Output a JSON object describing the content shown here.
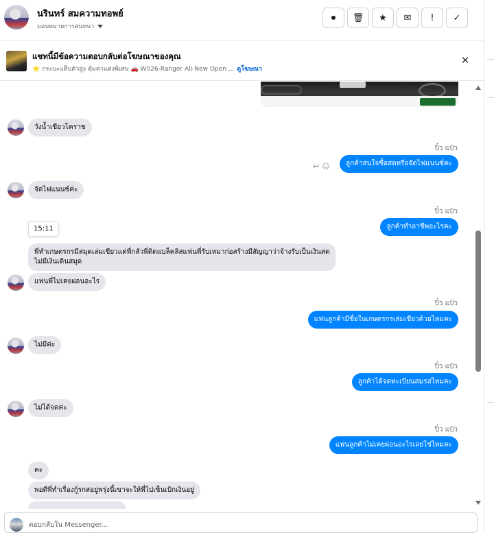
{
  "header": {
    "contact_name": "นรินทร์ สมความทอพย์",
    "assign_label": "มอบหมายการสนทนา",
    "toolbar": [
      {
        "icon": "alert-circle-icon",
        "glyph": "⏺"
      },
      {
        "icon": "trash-icon",
        "glyph": "🗑"
      },
      {
        "icon": "star-icon",
        "glyph": "★"
      },
      {
        "icon": "mail-icon",
        "glyph": "✉"
      },
      {
        "icon": "exclamation-icon",
        "glyph": "!"
      },
      {
        "icon": "check-icon",
        "glyph": "✓"
      }
    ]
  },
  "ad_banner": {
    "title": "แชทนี้มีข้อความตอบกลับต่อโฆษณาของคุณ",
    "subtitle": "⭐ กระบะแค็บตัวสูง คุ้มค่าแต่งพิเศษ 🚗 W026-Ranger All-New Open ...",
    "link": "ดูโฆษณา",
    "close_glyph": "✕"
  },
  "messages": [
    {
      "dir": "in",
      "text": "วังน้ำเขียวโคราช"
    },
    {
      "dir": "out",
      "sender": "ปิ๋ว แป๋ว",
      "text": "ลูกค้าสนใจซื้อสดหรือจัดไฟแนนซ์คะ"
    },
    {
      "dir": "in",
      "text": "จัดไฟแนนซ์ค่ะ"
    },
    {
      "dir": "out",
      "sender": "ปิ๋ว แป๋ว",
      "text": "ลูกค้าทำอาชีพอะไรคะ"
    },
    {
      "dir": "timestamp",
      "text": "15:11"
    },
    {
      "dir": "in",
      "text": "พี่ทำเกษตรกรมีสมุดเล่มเขียวแต่พี่กลัวพี่ติดแบล็คลิสแฟนพี่รับเหมาก่อสร้างมีสัญญาว่าจ้างรับเป็นเงินสด",
      "text2": "ไม่มีเงินเดินสมุด"
    },
    {
      "dir": "in",
      "text": "แฟนพี่ไม่เคยผ่อนอะไร"
    },
    {
      "dir": "out",
      "sender": "ปิ๋ว แป๋ว",
      "text": "แฟนลูกค้ามีชื่อในเกษตรกรเล่มเขียวด้วยไหมคะ"
    },
    {
      "dir": "in",
      "text": "ไม่มีค่ะ"
    },
    {
      "dir": "out",
      "sender": "ปิ๋ว แป๋ว",
      "text": "ลูกค้าได้จดทะเบียนสมรสไหมคะ"
    },
    {
      "dir": "in",
      "text": "ไม่ได้จดค่ะ"
    },
    {
      "dir": "out",
      "sender": "ปิ๋ว แป๋ว",
      "text": "แฟนลูกค้าไม่เคยผ่อนอะไรเลยใช่ไหมคะ"
    },
    {
      "dir": "in",
      "text": "คะ"
    },
    {
      "dir": "in",
      "text": "พอดีพี่ทำเรื่องกู้รกสอยู่พรุ่งนี้เขาจะให้พี่ไปเซ็นเบิกเงินอยู่"
    }
  ],
  "composer": {
    "placeholder": "ตอบกลับใน Messenger..."
  }
}
